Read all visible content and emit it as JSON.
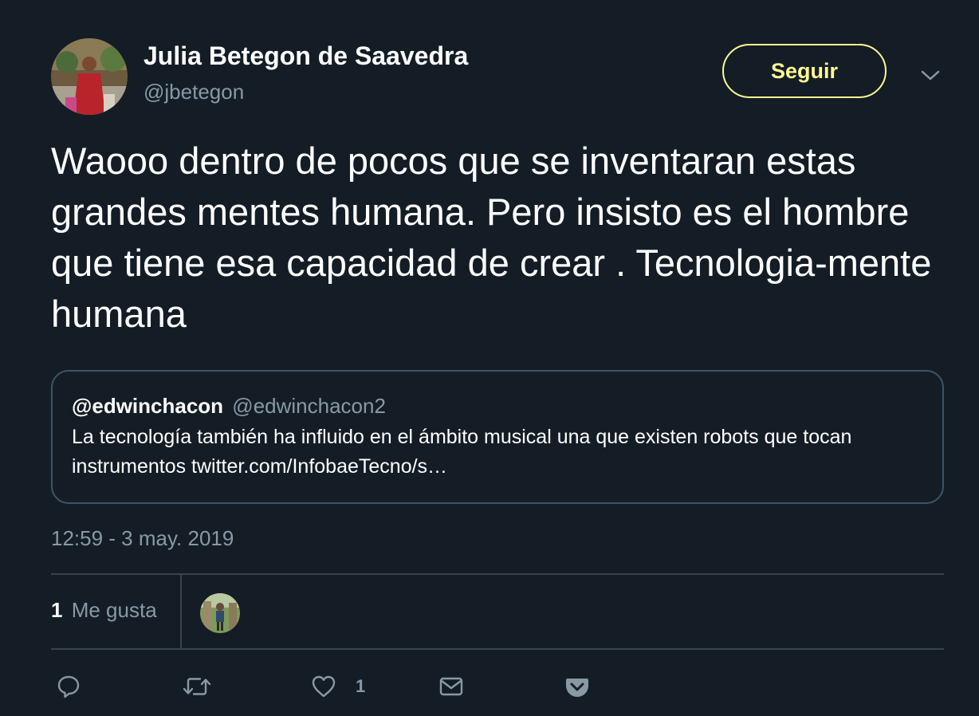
{
  "author": {
    "display_name": "Julia Betegon de Saavedra",
    "handle": "@jbetegon"
  },
  "follow_button": {
    "label": "Seguir"
  },
  "tweet": {
    "text": "Waooo dentro de pocos que se inventaran estas grandes mentes humana. Pero insisto es el hombre que tiene esa capacidad de crear . Tecnologia-mente humana",
    "timestamp": "12:59 - 3 may. 2019"
  },
  "quoted_tweet": {
    "display_name": "@edwinchacon",
    "handle": "@edwinchacon2",
    "text": "La tecnología también ha influido en el ámbito musical una que existen robots que tocan instrumentos twitter.com/InfobaeTecno/s…"
  },
  "stats": {
    "likes_count": "1",
    "likes_label": "Me gusta"
  },
  "actions": {
    "reply_icon": "reply-icon",
    "retweet_icon": "retweet-icon",
    "like_icon": "heart-icon",
    "like_count": "1",
    "dm_icon": "envelope-icon",
    "pocket_icon": "pocket-icon"
  },
  "colors": {
    "background": "#141d26",
    "follow_accent": "#fffa92",
    "secondary_text": "#8899a6",
    "border": "#38444d"
  }
}
